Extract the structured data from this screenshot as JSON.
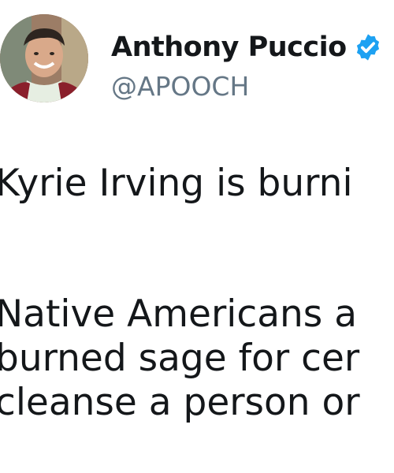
{
  "tweet": {
    "author": {
      "display_name": "Anthony Puccio",
      "handle": "@APOOCH",
      "verified": true,
      "avatar_icon": "profile-photo-avatar"
    },
    "text_lines": [
      "Kyrie Irving is burni",
      "Native Americans a",
      "burned sage for cer",
      "cleanse a person or"
    ]
  },
  "colors": {
    "text": "#14171a",
    "secondary_text": "#657786",
    "verified_blue": "#1da1f2",
    "background": "#ffffff"
  }
}
